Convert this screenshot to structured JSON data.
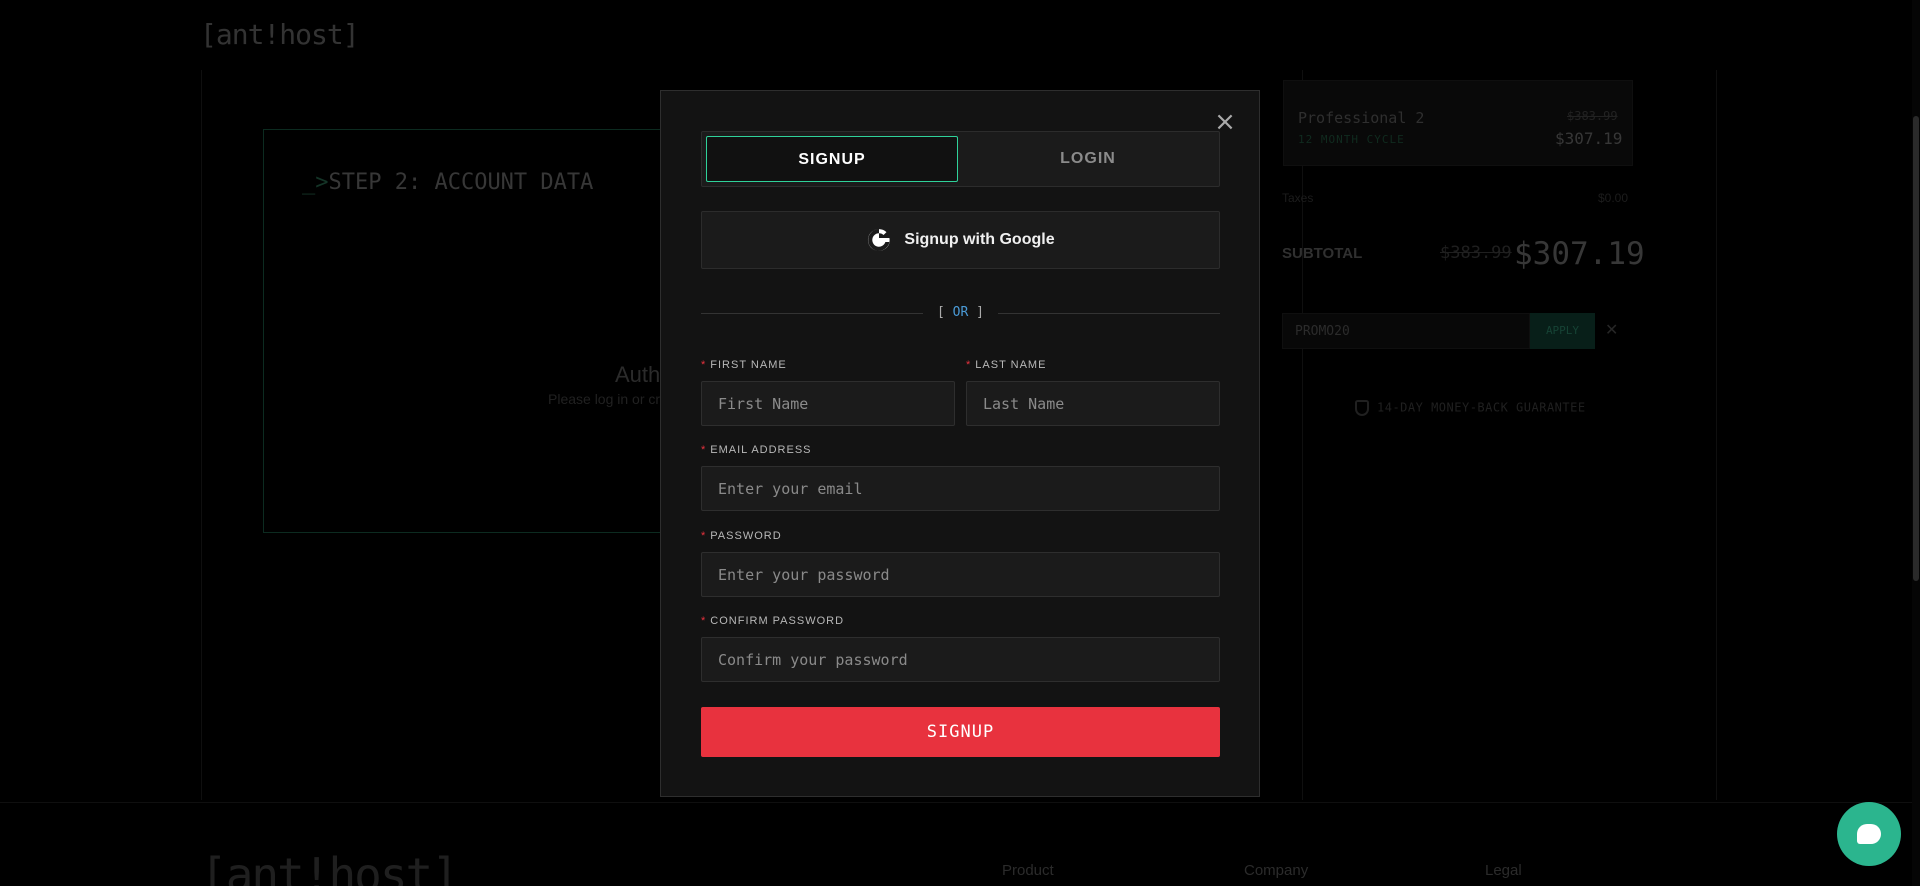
{
  "background": {
    "logo": "[ant!host]",
    "step_title_prompt": "_>",
    "step_title": "STEP 2: ACCOUNT DATA",
    "auth_title": "Auth",
    "auth_subtitle": "Please log in or cr",
    "plan": {
      "name": "Professional 2",
      "cycle": "12 MONTH CYCLE",
      "old_price": "$383.99",
      "new_price": "$307.19"
    },
    "taxes_label": "Taxes",
    "taxes_value": "$0.00",
    "subtotal_label": "SUBTOTAL",
    "subtotal_old": "$383.99",
    "subtotal_new": "$307.19",
    "promo_value": "PROMO20",
    "promo_apply": "APPLY",
    "promo_clear": "✕",
    "guarantee": "14-DAY MONEY-BACK GUARANTEE",
    "footer_logo": "[ant!host]",
    "footer_columns": [
      "Product",
      "Company",
      "Legal"
    ]
  },
  "modal": {
    "close_icon": "×",
    "tabs": {
      "signup": "SIGNUP",
      "login": "LOGIN"
    },
    "google_label": "Signup with Google",
    "or_left": "[ ",
    "or_word": "OR",
    "or_right": " ]",
    "required_mark": "*",
    "fields": {
      "first_name": {
        "label": "FIRST NAME",
        "placeholder": "First Name"
      },
      "last_name": {
        "label": "LAST NAME",
        "placeholder": "Last Name"
      },
      "email": {
        "label": "EMAIL ADDRESS",
        "placeholder": "Enter your email"
      },
      "password": {
        "label": "PASSWORD",
        "placeholder": "Enter your password"
      },
      "confirm_password": {
        "label": "CONFIRM PASSWORD",
        "placeholder": "Confirm your password"
      }
    },
    "submit_label": "SIGNUP"
  },
  "colors": {
    "accent_green": "#2fd29a",
    "danger_red": "#e8323e",
    "chat_green": "#2bb58e"
  },
  "icons": {
    "close": "close-icon",
    "google": "google-icon",
    "shield": "shield-icon",
    "chat": "chat-icon"
  }
}
